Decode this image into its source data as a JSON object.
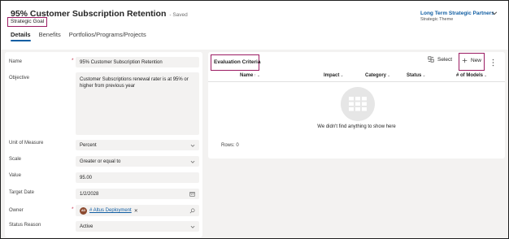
{
  "header": {
    "title": "95% Customer Subscription Retention",
    "saved_status": "- Saved",
    "entity_type": "Strategic Goal",
    "theme_link": "Long Term Strategic Partners",
    "theme_label": "Strategic Theme"
  },
  "tabs": [
    {
      "label": "Details",
      "active": true
    },
    {
      "label": "Benefits",
      "active": false
    },
    {
      "label": "Portfolios/Programs/Projects",
      "active": false
    }
  ],
  "form": {
    "name": {
      "label": "Name",
      "value": "95% Customer Subscription Retention",
      "required": "*"
    },
    "objective": {
      "label": "Objective",
      "value": "Customer Subscriptions renewal rater is at 95% or higher from previous year"
    },
    "unit": {
      "label": "Unit of Measure",
      "value": "Percent"
    },
    "scale": {
      "label": "Scale",
      "value": "Greater or equal to"
    },
    "value": {
      "label": "Value",
      "value": "95.00"
    },
    "target_date": {
      "label": "Target Date",
      "value": "1/2/2028"
    },
    "owner": {
      "label": "Owner",
      "required": "*",
      "avatar_initials": "AD",
      "value": "# Altus Deployment",
      "remove": "✕"
    },
    "status_reason": {
      "label": "Status Reason",
      "value": "Active"
    }
  },
  "evaluation": {
    "title": "Evaluation Criteria",
    "select_label": "Select",
    "new_label": "New",
    "columns": [
      {
        "label": "Name",
        "sort": "↑",
        "caret": "⌄"
      },
      {
        "label": "Impact",
        "caret": "⌄"
      },
      {
        "label": "Category",
        "caret": "⌄"
      },
      {
        "label": "Status",
        "caret": "⌄"
      },
      {
        "label": "# of Models",
        "caret": "⌄"
      }
    ],
    "empty_message": "We didn't find anything to show here",
    "rows_count": "Rows: 0"
  },
  "colors": {
    "accent": "#115ea3",
    "highlight_box": "#9b1c63",
    "required": "#c4314b",
    "canvas": "#f3f2f1"
  }
}
